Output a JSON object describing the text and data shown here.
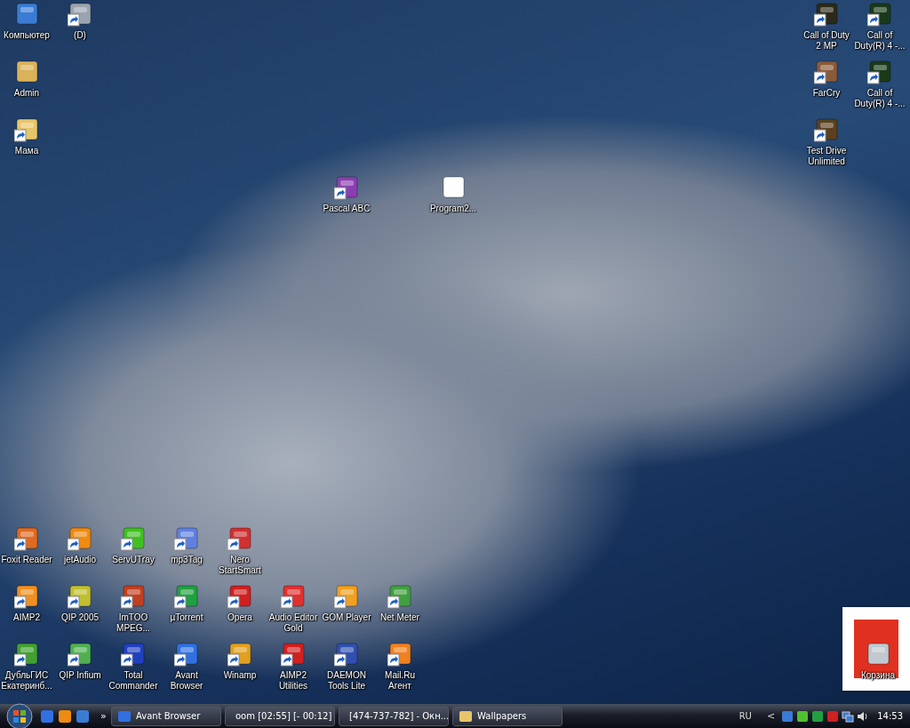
{
  "desktop_icons": [
    {
      "label": "Компьютер",
      "shortcut": false
    },
    {
      "label": "(D)",
      "shortcut": true
    },
    {
      "label": "Admin",
      "shortcut": false
    },
    {
      "label": "Мама",
      "shortcut": true
    },
    {
      "label": "Pascal ABC",
      "shortcut": true
    },
    {
      "label": "Program2...",
      "shortcut": false
    },
    {
      "label": "Call of Duty 2 MP",
      "shortcut": true
    },
    {
      "label": "Call of Duty(R) 4 -...",
      "shortcut": true
    },
    {
      "label": "FarCry",
      "shortcut": true
    },
    {
      "label": "Call of Duty(R) 4 -...",
      "shortcut": true
    },
    {
      "label": "Test Drive Unlimited",
      "shortcut": true
    },
    {
      "label": "Foxit Reader",
      "shortcut": true
    },
    {
      "label": "jetAudio",
      "shortcut": true
    },
    {
      "label": "ServUTray",
      "shortcut": true
    },
    {
      "label": "mp3Tag",
      "shortcut": true
    },
    {
      "label": "Nero StartSmart",
      "shortcut": true
    },
    {
      "label": "AIMP2",
      "shortcut": true
    },
    {
      "label": "QIP 2005",
      "shortcut": true
    },
    {
      "label": "ImTOO MPEG...",
      "shortcut": true
    },
    {
      "label": "µTorrent",
      "shortcut": true
    },
    {
      "label": "Opera",
      "shortcut": true
    },
    {
      "label": "Audio Editor Gold",
      "shortcut": true
    },
    {
      "label": "GOM Player",
      "shortcut": true
    },
    {
      "label": "Net Meter",
      "shortcut": true
    },
    {
      "label": "ДубльГИС Екатеринб...",
      "shortcut": true
    },
    {
      "label": "QIP Infium",
      "shortcut": true
    },
    {
      "label": "Total Commander",
      "shortcut": true
    },
    {
      "label": "Avant Browser",
      "shortcut": true
    },
    {
      "label": "Winamp",
      "shortcut": true
    },
    {
      "label": "AIMP2 Utilities",
      "shortcut": true
    },
    {
      "label": "DAEMON Tools Lite",
      "shortcut": true
    },
    {
      "label": "Mail.Ru Агент",
      "shortcut": true
    },
    {
      "label": "Корзина",
      "shortcut": false
    }
  ],
  "taskbar": {
    "quick_launch_more": "»",
    "tasks": [
      {
        "label": "Avant Browser",
        "selected": false
      },
      {
        "label": "oom [02:55] [- 00:12]",
        "selected": false
      },
      {
        "label": "[474-737-782] - Окн...",
        "selected": false
      },
      {
        "label": "Wallpapers",
        "selected": false
      }
    ],
    "language": "RU",
    "tray_expand": "<",
    "clock": "14:53"
  }
}
